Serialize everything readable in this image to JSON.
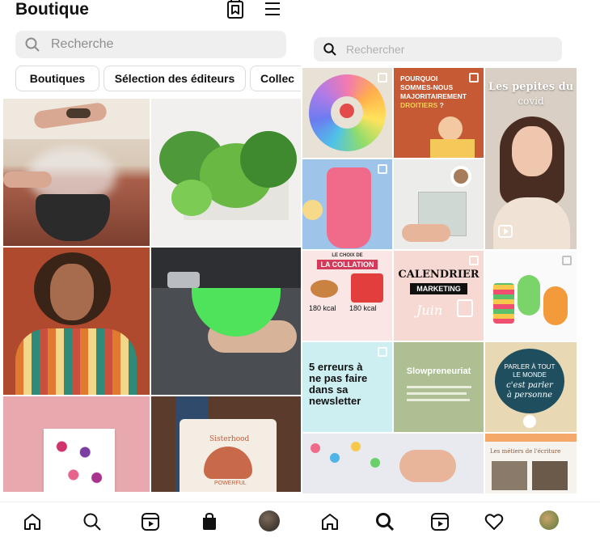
{
  "left": {
    "title": "Boutique",
    "icons": {
      "saved": "bookmark-shop-icon",
      "menu": "hamburger-menu-icon"
    },
    "search": {
      "placeholder": "Recherche"
    },
    "chips": [
      "Boutiques",
      "Sélection des éditeurs",
      "Collec"
    ],
    "tiles": [
      {
        "name": "tile-hands-incense",
        "desc": "hands over smoking cauldron"
      },
      {
        "name": "tile-green-plants",
        "desc": "green plant wall planter"
      },
      {
        "name": "tile-woman-knit-top",
        "desc": "woman in patterned knit top"
      },
      {
        "name": "tile-green-sponge",
        "desc": "green knitted citrus sponge"
      },
      {
        "name": "tile-floral-print",
        "desc": "floral art print on pink"
      },
      {
        "name": "tile-tote-bag",
        "desc": "sisterhood tote bag"
      }
    ],
    "tote_text_1": "Sisterhood",
    "tote_text_2": "POWERFUL",
    "nav": [
      "home-icon",
      "search-icon",
      "reels-icon",
      "shop-icon",
      "profile-avatar"
    ]
  },
  "right": {
    "search": {
      "placeholder": "Rechercher"
    },
    "tiles": {
      "t2": {
        "line1": "POURQUOI",
        "line2": "SOMMES-NOUS",
        "line3": "MAJORITAIREMENT",
        "line4": "DROITIERS",
        "line4b": " ?"
      },
      "t3": {
        "line1": "Les pepites du",
        "line2": "covid"
      },
      "t7": {
        "top": "LE CHOIX DE",
        "title": "LA COLLATION",
        "kcal1": "180 kcal",
        "kcal2": "180 kcal"
      },
      "t8": {
        "line1": "CALENDRIER",
        "badge": "MARKETING",
        "month": "Juin"
      },
      "t10": {
        "line1": "5 erreurs à",
        "line2": "ne pas faire",
        "line3": "dans sa",
        "line4": "newsletter"
      },
      "t11": {
        "title": "Slowpreneuriat"
      },
      "t12": {
        "line1": "PARLER À TOUT",
        "line2": "LE MONDE",
        "line3": "c'est parler",
        "line4": "à personne"
      },
      "t15": {
        "title": "Les métiers de l'écriture"
      }
    },
    "nav": [
      "home-icon",
      "search-icon",
      "reels-icon",
      "heart-icon",
      "profile-avatar"
    ]
  },
  "colors": {
    "text": "#262626",
    "placeholder": "#8e8e8e",
    "search_bg": "#efefef",
    "border": "#dbdbdb",
    "orange": "#c65a35",
    "teal_bg": "#cdeff2",
    "sage": "#aebf93",
    "navy": "#1f4e5f"
  }
}
